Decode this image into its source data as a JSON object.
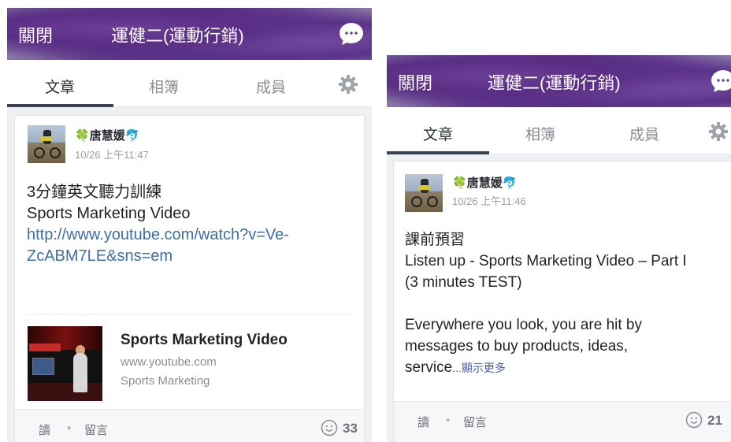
{
  "screens": [
    {
      "header": {
        "close_label": "關閉",
        "title": "運健二(運動行銷)",
        "chat_icon": "chat-bubble-icon"
      },
      "tabs": {
        "posts": "文章",
        "albums": "相簿",
        "members": "成員",
        "settings_icon": "gear-icon"
      },
      "post": {
        "author": "唐慧媛",
        "author_prefix_emoji": "🍀",
        "author_suffix_emoji": "🐬",
        "time": "10/26 上午11:47",
        "text_line1": "3分鐘英文聽力訓練",
        "text_line2": "Sports Marketing Video",
        "link_line1": "http://www.youtube.com/watch?v=Ve-",
        "link_line2": "ZcABM7LE&sns=em",
        "preview": {
          "title": "Sports Marketing Video",
          "domain": "www.youtube.com",
          "description": "Sports Marketing"
        },
        "footer": {
          "read_label": "讀",
          "separator": "•",
          "comment_label": "留言",
          "reaction_count": "33"
        }
      }
    },
    {
      "header": {
        "close_label": "關閉",
        "title": "運健二(運動行銷)",
        "chat_icon": "chat-bubble-icon"
      },
      "tabs": {
        "posts": "文章",
        "albums": "相簿",
        "members": "成員",
        "settings_icon": "gear-icon"
      },
      "post": {
        "author": "唐慧媛",
        "author_prefix_emoji": "🍀",
        "author_suffix_emoji": "🐬",
        "time": "10/26 上午11:46",
        "text_line1": "課前預習",
        "text_line2": "Listen up - Sports Marketing Video – Part I",
        "text_line3": "(3 minutes TEST)",
        "text_line4": "Everywhere you look, you are hit by",
        "text_line5": "messages to buy products, ideas,",
        "text_line6": "service",
        "ellipsis": "...",
        "show_more": "顯示更多",
        "footer": {
          "read_label": "讀",
          "separator": "•",
          "comment_label": "留言",
          "reaction_count": "21"
        }
      }
    }
  ],
  "colors": {
    "header_purple": "#5a2e85",
    "link_blue": "#3c6fa8",
    "tab_indicator": "#3b4350"
  }
}
